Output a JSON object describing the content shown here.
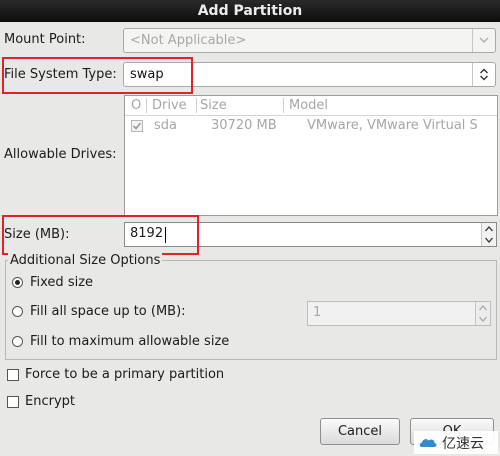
{
  "window": {
    "title": "Add Partition"
  },
  "mount_point": {
    "label": "Mount Point:",
    "value": "<Not Applicable>"
  },
  "fs_type": {
    "label": "File System Type:",
    "value": "swap"
  },
  "drives": {
    "label": "Allowable Drives:",
    "columns": [
      "Drive",
      "Size",
      "Model"
    ],
    "rows": [
      {
        "drive": "sda",
        "size": "30720 MB",
        "model": "VMware, VMware Virtual S"
      }
    ]
  },
  "size": {
    "label": "Size (MB):",
    "value": "8192"
  },
  "size_options": {
    "title": "Additional Size Options",
    "fixed": "Fixed size",
    "fill_up_to": "Fill all space up to (MB):",
    "fill_up_to_value": "1",
    "fill_max": "Fill to maximum allowable size"
  },
  "force_primary": {
    "label": "Force to be a primary partition"
  },
  "encrypt": {
    "label": "Encrypt"
  },
  "buttons": {
    "cancel": "Cancel",
    "ok": "OK"
  },
  "watermark": {
    "text": "亿速云"
  },
  "colors": {
    "highlight": "#e3212a",
    "titlebar": "#1a1a1a"
  }
}
